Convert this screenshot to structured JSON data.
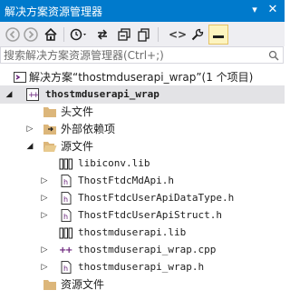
{
  "window": {
    "title": "解决方案资源管理器",
    "pin_icon": "pin-icon",
    "close_icon": "close-icon"
  },
  "toolbar": {
    "buttons": [
      {
        "name": "back-icon",
        "glyph": "◀"
      },
      {
        "name": "forward-icon",
        "glyph": "▶"
      },
      {
        "name": "home-icon",
        "glyph": "⌂"
      },
      {
        "name": "history-icon",
        "glyph": "⟲"
      },
      {
        "name": "sync-icon",
        "glyph": "⇄"
      },
      {
        "name": "collapse-all-icon",
        "glyph": "⧉"
      },
      {
        "name": "show-all-files-icon",
        "glyph": "❐"
      },
      {
        "name": "view-code-icon",
        "glyph": "<>"
      },
      {
        "name": "properties-icon",
        "glyph": "🔧"
      },
      {
        "name": "preview-icon",
        "glyph": "▬"
      }
    ]
  },
  "search": {
    "placeholder": "搜索解决方案资源管理器(Ctrl+;)"
  },
  "tree": {
    "solution_label": "解决方案“thostmduserapi_wrap”(1 个项目)",
    "project_label": "thostmduserapi_wrap",
    "items": [
      {
        "label": "头文件"
      },
      {
        "label": "外部依赖项"
      },
      {
        "label": "源文件"
      },
      {
        "label": "libiconv.lib"
      },
      {
        "label": "ThostFtdcMdApi.h"
      },
      {
        "label": "ThostFtdcUserApiDataType.h"
      },
      {
        "label": "ThostFtdcUserApiStruct.h"
      },
      {
        "label": "thostmduserapi.lib"
      },
      {
        "label": "thostmduserapi_wrap.cpp"
      },
      {
        "label": "thostmduserapi_wrap.h"
      },
      {
        "label": "资源文件"
      }
    ]
  },
  "colors": {
    "accent": "#007acc",
    "folder": "#dcb67a",
    "toolbar": "#eeeef2",
    "selection": "#e3e3e6"
  }
}
